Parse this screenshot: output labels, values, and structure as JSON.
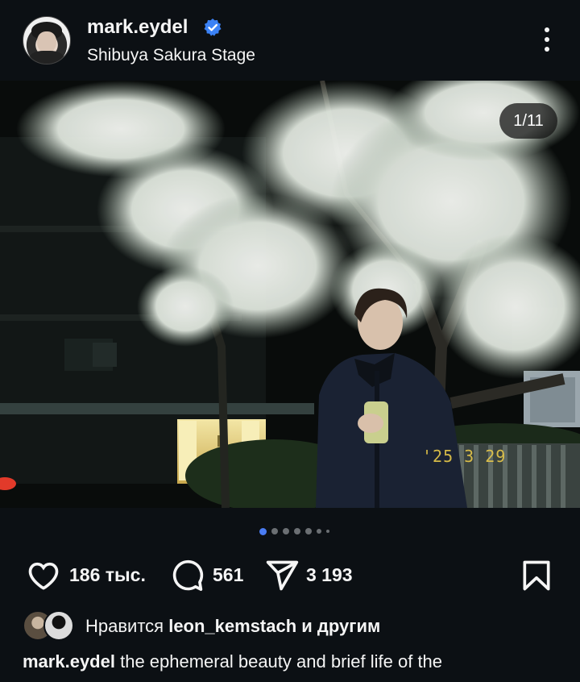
{
  "post": {
    "username": "mark.eydel",
    "location": "Shibuya Sakura Stage",
    "media_counter": "1/11",
    "datestamp": "'25 3 29",
    "carousel": {
      "total_dots_visible": 7,
      "active_index": 0
    }
  },
  "actions": {
    "likes_count": "186 тыс.",
    "comments_count": "561",
    "shares_count": "3 193"
  },
  "likes_line": {
    "prefix": "Нравится",
    "user": "leon_kemstach",
    "suffix": "и другим"
  },
  "caption": {
    "author": "mark.eydel",
    "text": "the ephemeral beauty and brief life of the"
  },
  "icons": {
    "verified": "verified-badge-icon",
    "more": "more-vertical-icon",
    "like": "heart-icon",
    "comment": "comment-bubble-icon",
    "share": "paper-plane-icon",
    "save": "bookmark-icon"
  },
  "colors": {
    "background": "#0c1014",
    "text": "#f5f5f5",
    "verified": "#3b82f6",
    "active_dot": "#4a7cf3",
    "datestamp": "#e8c94a"
  }
}
